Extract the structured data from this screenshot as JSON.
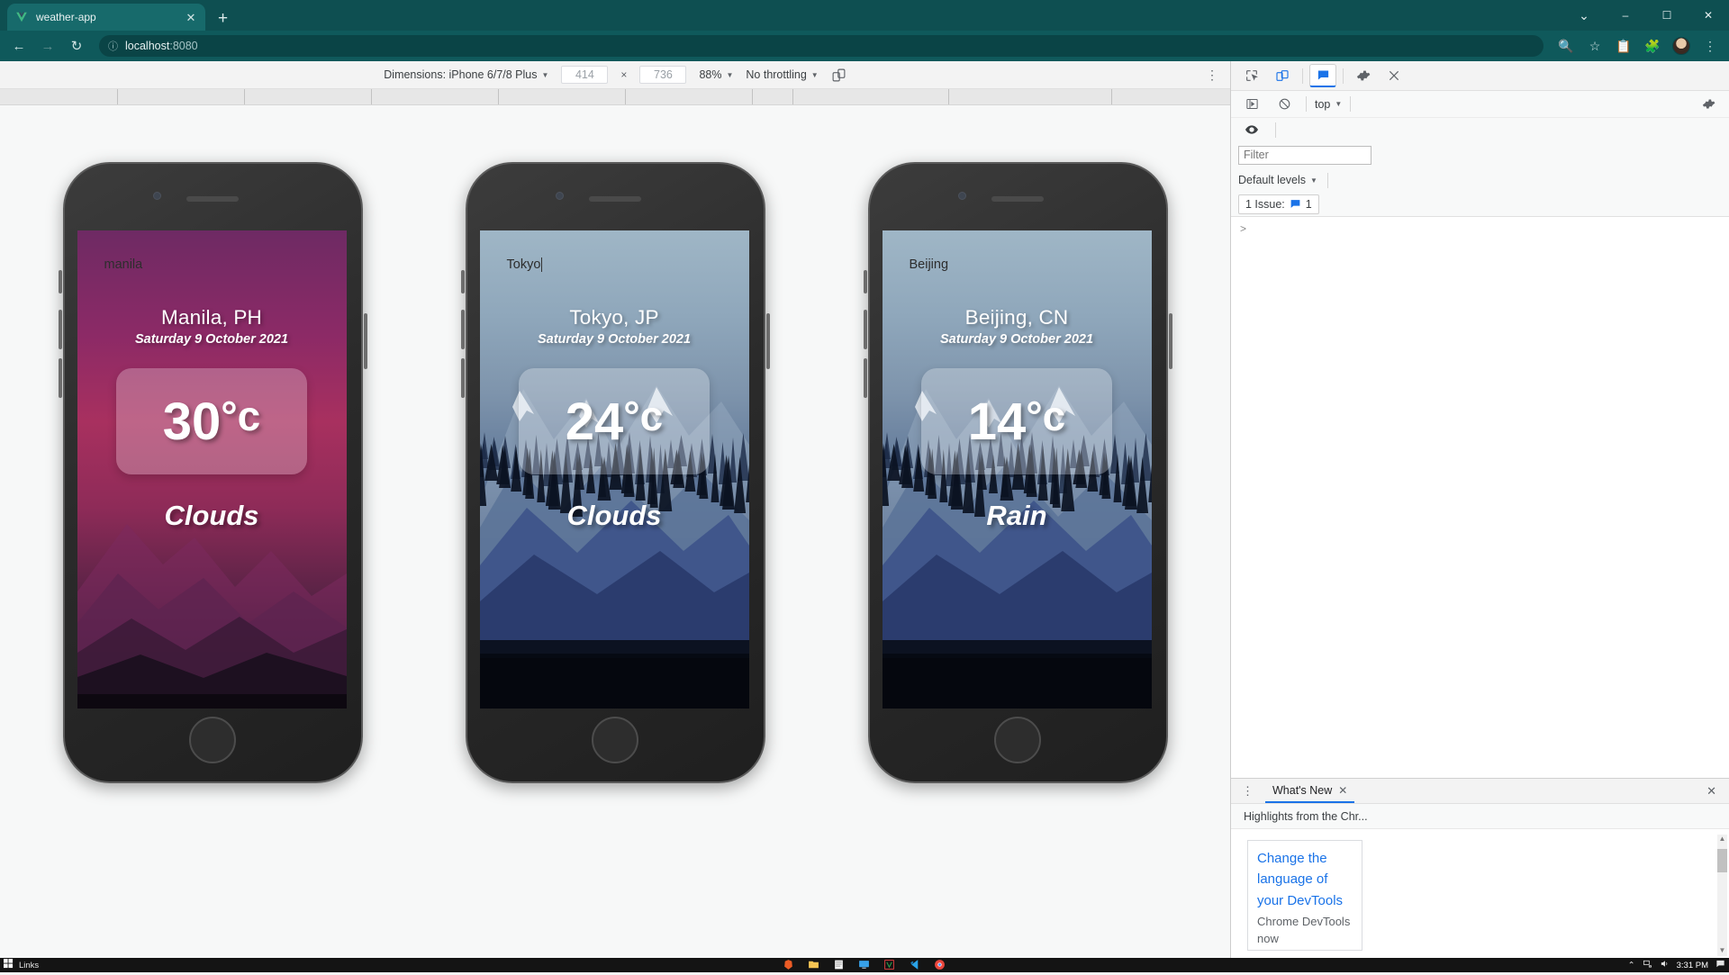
{
  "browser": {
    "tab": {
      "title": "weather-app",
      "favicon_icon": "vue-v-icon",
      "close_icon": "close-icon"
    },
    "new_tab_icon": "plus-icon",
    "window_controls": {
      "minimize": "–",
      "maximize": "❐",
      "close": "✕",
      "chevron": "⌄"
    },
    "nav": {
      "back_icon": "arrow-left-icon",
      "forward_icon": "arrow-right-icon",
      "reload_icon": "reload-icon",
      "info_icon": "info-circle-icon",
      "url_host": "localhost",
      "url_port": ":8080"
    },
    "toolbar_icons": [
      "zoom-magnifier-icon",
      "bookmark-star-icon",
      "clipboard-icon",
      "extensions-puzzle-icon",
      "profile-avatar",
      "menu-kebab-icon"
    ]
  },
  "device_toolbar": {
    "dimensions_label": "Dimensions: iPhone 6/7/8 Plus",
    "dimensions_caret": "▼",
    "width": "414",
    "times": "×",
    "height": "736",
    "zoom": "88%",
    "zoom_caret": "▼",
    "throttling": "No throttling",
    "throttling_caret": "▼",
    "rotate_icon": "rotate-device-icon",
    "more_icon": "kebab-menu-icon"
  },
  "phones": [
    {
      "id": "manila",
      "theme": "purple",
      "search_value": "manila",
      "search_focused": false,
      "city": "Manila, PH",
      "date": "Saturday 9 October 2021",
      "temperature": "30",
      "degree": "°c",
      "condition": "Clouds"
    },
    {
      "id": "tokyo",
      "theme": "blue",
      "search_value": "Tokyo",
      "search_focused": true,
      "city": "Tokyo, JP",
      "date": "Saturday 9 October 2021",
      "temperature": "24",
      "degree": "°c",
      "condition": "Clouds"
    },
    {
      "id": "beijing",
      "theme": "blue",
      "search_value": "Beijing",
      "search_focused": false,
      "city": "Beijing, CN",
      "date": "Saturday 9 October 2021",
      "temperature": "14",
      "degree": "°c",
      "condition": "Rain"
    }
  ],
  "devtools": {
    "tab_icons": [
      "inspect-element-icon",
      "device-toggle-icon",
      "console-tab-icon",
      "settings-gear-icon",
      "close-devtools-icon"
    ],
    "context": {
      "run_icon": "execution-context-icon",
      "clear_icon": "clear-console-icon",
      "selector": "top",
      "selector_caret": "▼",
      "settings_icon": "console-settings-icon"
    },
    "eye_icon": "eye-icon",
    "filter_placeholder": "Filter",
    "filter_value": "",
    "levels_label": "Default levels",
    "levels_caret": "▼",
    "issues_label": "1 Issue:",
    "issues_count": "1",
    "issues_icon": "issue-message-icon",
    "prompt_symbol": ">",
    "drawer": {
      "kebab_icon": "drawer-menu-icon",
      "tab_label": "What's New",
      "tab_close": "✕",
      "drawer_close": "✕",
      "subtitle": "Highlights from the Chr...",
      "link_text": "Change the language of your DevTools",
      "description": "Chrome DevTools now"
    }
  },
  "taskbar": {
    "start_icon": "windows-start-icon",
    "links_label": "Links",
    "apps": [
      "brave-icon",
      "file-explorer-icon",
      "notepad-icon",
      "remote-desktop-icon",
      "vim-icon",
      "vscode-icon",
      "chrome-icon"
    ],
    "tray": {
      "chevron": "⌃",
      "network_icon": "network-icon",
      "volume_icon": "volume-icon",
      "clock": "3:31 PM",
      "notifications_icon": "notification-icon"
    }
  }
}
